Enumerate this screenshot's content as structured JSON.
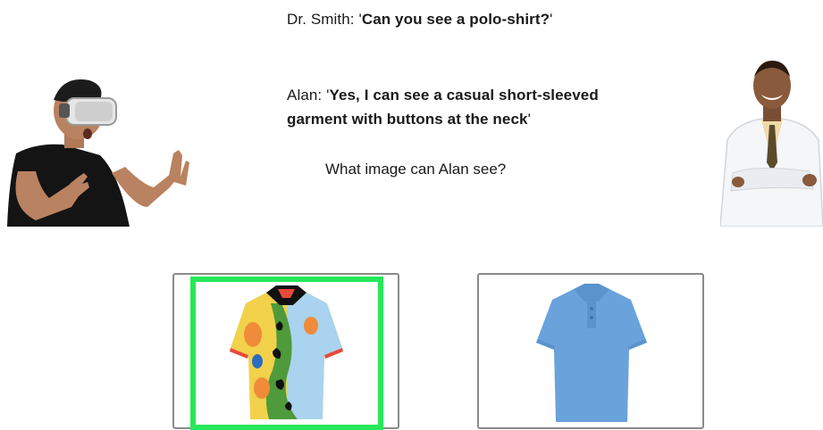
{
  "dialog": {
    "smith_speaker": "Dr. Smith: ",
    "smith_quote_open": "'",
    "smith_text": "Can you see a polo-shirt?",
    "smith_quote_close": "'",
    "alan_speaker": "Alan: ",
    "alan_quote_open": "'",
    "alan_text": "Yes, I can see a casual short-sleeved garment with buttons at the neck",
    "alan_quote_close": "'"
  },
  "question": "What image can Alan see?",
  "options": [
    {
      "name": "patterned-polo-shirt",
      "selected": true
    },
    {
      "name": "blue-polo-shirt",
      "selected": false
    }
  ],
  "colors": {
    "selection": "#27e85a",
    "card_border": "#8a8a8a",
    "blue_shirt": "#6aa2db"
  }
}
